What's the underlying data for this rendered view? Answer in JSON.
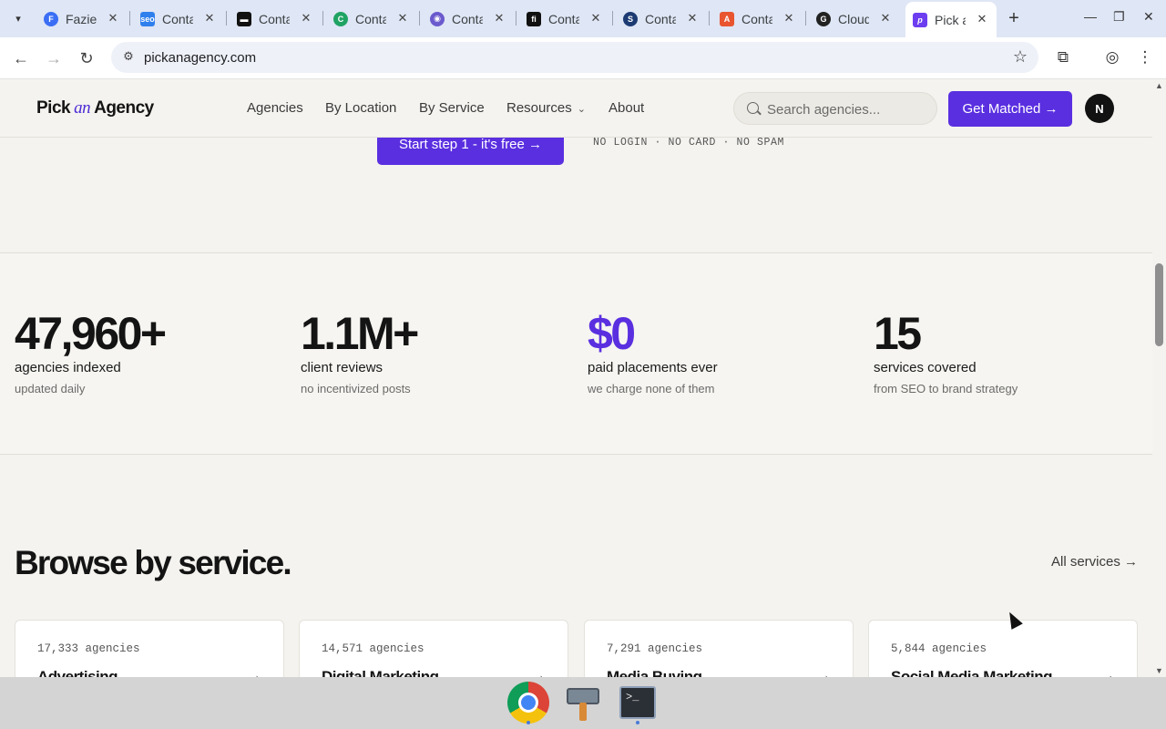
{
  "browser": {
    "tabs": [
      {
        "label": "Fazier",
        "favicon": "fazier-icon",
        "color": "#3b6ef5"
      },
      {
        "label": "Conta",
        "favicon": "seo-icon",
        "color": "#2f80ed"
      },
      {
        "label": "Conta",
        "favicon": "dark-logo-icon",
        "color": "#111111"
      },
      {
        "label": "Conta",
        "favicon": "green-c-icon",
        "color": "#1fa363"
      },
      {
        "label": "Conta",
        "favicon": "podcast-icon",
        "color": "#6a5acd"
      },
      {
        "label": "Conta",
        "favicon": "fi-icon",
        "color": "#111111"
      },
      {
        "label": "Conta",
        "favicon": "s-icon",
        "color": "#1d3b73"
      },
      {
        "label": "Conta",
        "favicon": "colorful-a-icon",
        "color": "#e8552f"
      },
      {
        "label": "Cloud",
        "favicon": "cloud-icon",
        "color": "#222222"
      },
      {
        "label": "Pick a",
        "favicon": "pick-icon",
        "color": "#6c3ef0",
        "active": true
      }
    ],
    "url": "pickanagency.com"
  },
  "header": {
    "logo_pick": "Pick",
    "logo_an": "an",
    "logo_agency": "Agency",
    "nav": [
      "Agencies",
      "By Location",
      "By Service",
      "Resources",
      "About"
    ],
    "search_placeholder": "Search agencies...",
    "cta": "Get Matched →",
    "avatar_initial": "N"
  },
  "hero": {
    "step_button": "Start step 1 - it's free →",
    "fineprint": "NO LOGIN · NO CARD · NO SPAM"
  },
  "stats": [
    {
      "value": "47,960+",
      "label": "agencies indexed",
      "sub": "updated daily"
    },
    {
      "value": "1.1M+",
      "label": "client reviews",
      "sub": "no incentivized posts"
    },
    {
      "value": "$0",
      "label": "paid placements ever",
      "sub": "we charge none of them",
      "accent": "#5a2fe0"
    },
    {
      "value": "15",
      "label": "services covered",
      "sub": "from SEO to brand strategy"
    }
  ],
  "browse": {
    "title": "Browse by service.",
    "all_link": "All services →",
    "cards": [
      {
        "count": "17,333 agencies",
        "name": "Advertising",
        "arrow": "→"
      },
      {
        "count": "14,571 agencies",
        "name": "Digital Marketing",
        "arrow": "→"
      },
      {
        "count": "7,291 agencies",
        "name": "Media Buying",
        "arrow": "→"
      },
      {
        "count": "5,844 agencies",
        "name": "Social Media Marketing",
        "arrow": "→"
      }
    ]
  },
  "colors": {
    "brand": "#5a2fe0",
    "background": "#f4f3ef"
  }
}
